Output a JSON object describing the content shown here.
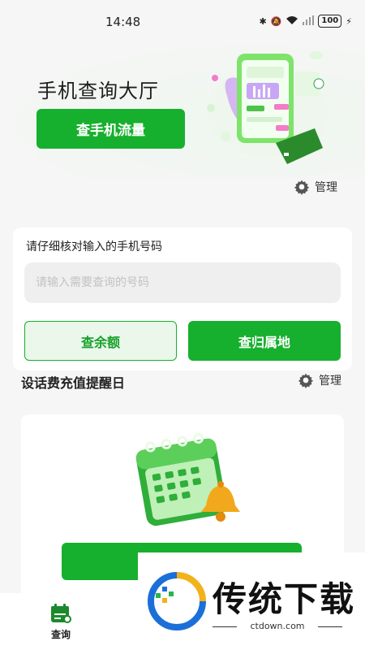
{
  "status_bar": {
    "time": "14:48",
    "battery": "100"
  },
  "hero": {
    "title": "手机查询大厅",
    "button_label": "查手机流量"
  },
  "manage_top": {
    "label": "管理"
  },
  "query_card": {
    "hint": "请仔细核对输入的手机号码",
    "input_placeholder": "请输入需要查询的号码",
    "input_value": "",
    "balance_button": "查余额",
    "location_button": "查归属地"
  },
  "reminder": {
    "title": "设话费充值提醒日",
    "manage_label": "管理"
  },
  "bottom_nav": {
    "items": [
      {
        "label": "查询",
        "icon": "query-calendar-icon",
        "active": true
      }
    ]
  },
  "watermark": {
    "brand": "传统下载",
    "domain": "ctdown.com"
  },
  "colors": {
    "primary_green": "#17b02e",
    "light_green": "#eaf7ea",
    "background": "#f5f6f5"
  }
}
